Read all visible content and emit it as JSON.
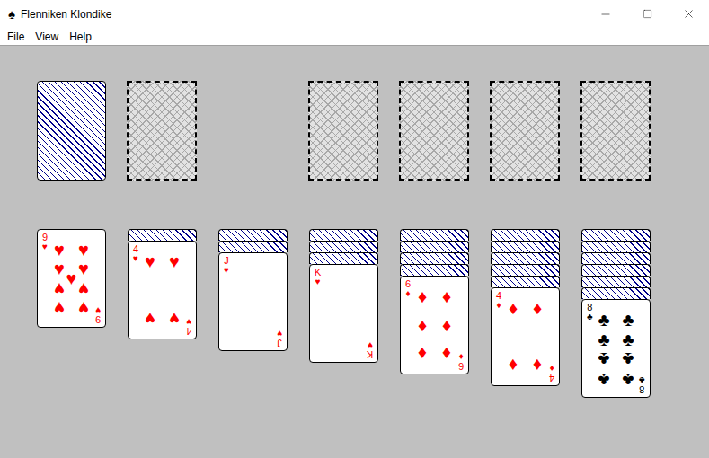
{
  "window": {
    "title": "Flenniken Klondike",
    "icon": "♠"
  },
  "menu": [
    "File",
    "View",
    "Help"
  ],
  "stock": {
    "has_cards": true
  },
  "waste": {
    "has_cards": false
  },
  "foundations": [
    {
      "has_cards": false
    },
    {
      "has_cards": false
    },
    {
      "has_cards": false
    },
    {
      "has_cards": false
    }
  ],
  "tableau": [
    {
      "face_down": 0,
      "face_up": [
        {
          "rank": "9",
          "suit": "♥",
          "color": "#ff0000"
        }
      ]
    },
    {
      "face_down": 1,
      "face_up": [
        {
          "rank": "4",
          "suit": "♥",
          "color": "#ff0000"
        }
      ]
    },
    {
      "face_down": 2,
      "face_up": [
        {
          "rank": "J",
          "suit": "♥",
          "color": "#ff0000"
        }
      ]
    },
    {
      "face_down": 3,
      "face_up": [
        {
          "rank": "K",
          "suit": "♥",
          "color": "#ff0000"
        }
      ]
    },
    {
      "face_down": 4,
      "face_up": [
        {
          "rank": "6",
          "suit": "♦",
          "color": "#ff0000"
        }
      ]
    },
    {
      "face_down": 5,
      "face_up": [
        {
          "rank": "4",
          "suit": "♦",
          "color": "#ff0000"
        }
      ]
    },
    {
      "face_down": 6,
      "face_up": [
        {
          "rank": "8",
          "suit": "♣",
          "color": "#000000"
        }
      ]
    }
  ]
}
